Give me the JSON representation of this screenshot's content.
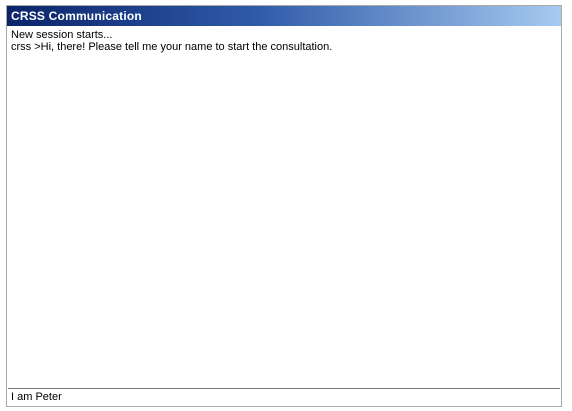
{
  "window": {
    "title": "CRSS Communication"
  },
  "conversation": {
    "lines": [
      "New session starts...",
      "crss >Hi, there! Please tell me your name to start the consultation."
    ]
  },
  "input": {
    "value": "I am Peter"
  }
}
